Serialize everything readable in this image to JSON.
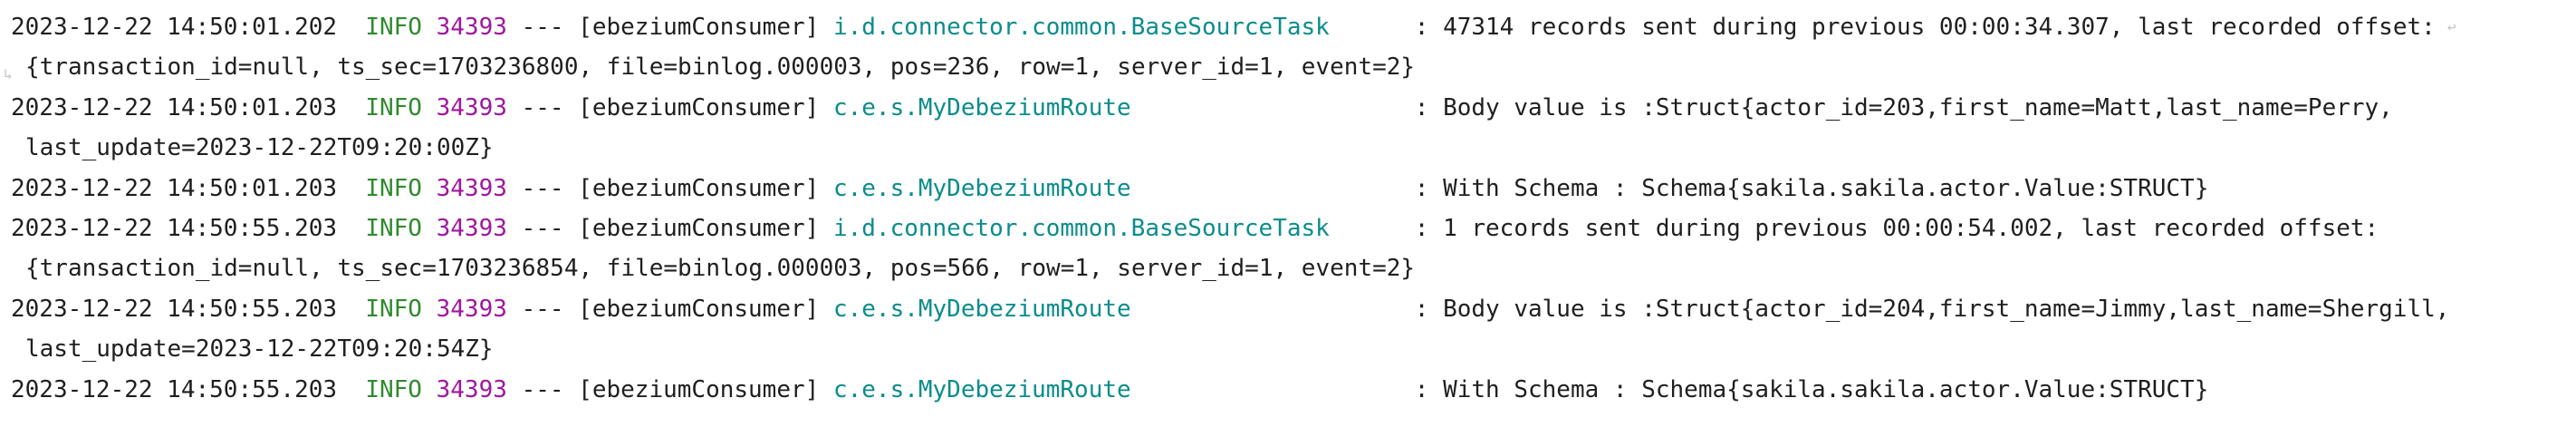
{
  "colors": {
    "background": "#ffffff",
    "text": "#1f1f1f",
    "level": "#2f8a2f",
    "pid": "#a1169f",
    "logger": "#0b8c8c",
    "soft_wrap_marker": "#c4c4c4"
  },
  "icons": {
    "soft_wrap_end": "soft-wrap-end-icon",
    "soft_wrap_start": "soft-wrap-start-icon"
  },
  "log": [
    {
      "date": "2023-12-22 14:50:01.202",
      "level": "INFO",
      "pid": "34393",
      "sep": "---",
      "thread": "[ebeziumConsumer]",
      "logger": "i.d.connector.common.BaseSourceTask",
      "message": "47314 records sent during previous 00:00:34.307, last recorded offset:",
      "continuation": "{transaction_id=null, ts_sec=1703236800, file=binlog.000003, pos=236, row=1, server_id=1, event=2}"
    },
    {
      "date": "2023-12-22 14:50:01.203",
      "level": "INFO",
      "pid": "34393",
      "sep": "---",
      "thread": "[ebeziumConsumer]",
      "logger": "c.e.s.MyDebeziumRoute",
      "message": "Body value is :Struct{actor_id=203,first_name=Matt,last_name=Perry,",
      "continuation": "last_update=2023-12-22T09:20:00Z}"
    },
    {
      "date": "2023-12-22 14:50:01.203",
      "level": "INFO",
      "pid": "34393",
      "sep": "---",
      "thread": "[ebeziumConsumer]",
      "logger": "c.e.s.MyDebeziumRoute",
      "message": "With Schema : Schema{sakila.sakila.actor.Value:STRUCT}",
      "continuation": ""
    },
    {
      "date": "2023-12-22 14:50:55.203",
      "level": "INFO",
      "pid": "34393",
      "sep": "---",
      "thread": "[ebeziumConsumer]",
      "logger": "i.d.connector.common.BaseSourceTask",
      "message": "1 records sent during previous 00:00:54.002, last recorded offset:",
      "continuation": "{transaction_id=null, ts_sec=1703236854, file=binlog.000003, pos=566, row=1, server_id=1, event=2}"
    },
    {
      "date": "2023-12-22 14:50:55.203",
      "level": "INFO",
      "pid": "34393",
      "sep": "---",
      "thread": "[ebeziumConsumer]",
      "logger": "c.e.s.MyDebeziumRoute",
      "message": "Body value is :Struct{actor_id=204,first_name=Jimmy,last_name=Shergill,",
      "continuation": "last_update=2023-12-22T09:20:54Z}"
    },
    {
      "date": "2023-12-22 14:50:55.203",
      "level": "INFO",
      "pid": "34393",
      "sep": "---",
      "thread": "[ebeziumConsumer]",
      "logger": "c.e.s.MyDebeziumRoute",
      "message": "With Schema : Schema{sakila.sakila.actor.Value:STRUCT}",
      "continuation": ""
    }
  ]
}
